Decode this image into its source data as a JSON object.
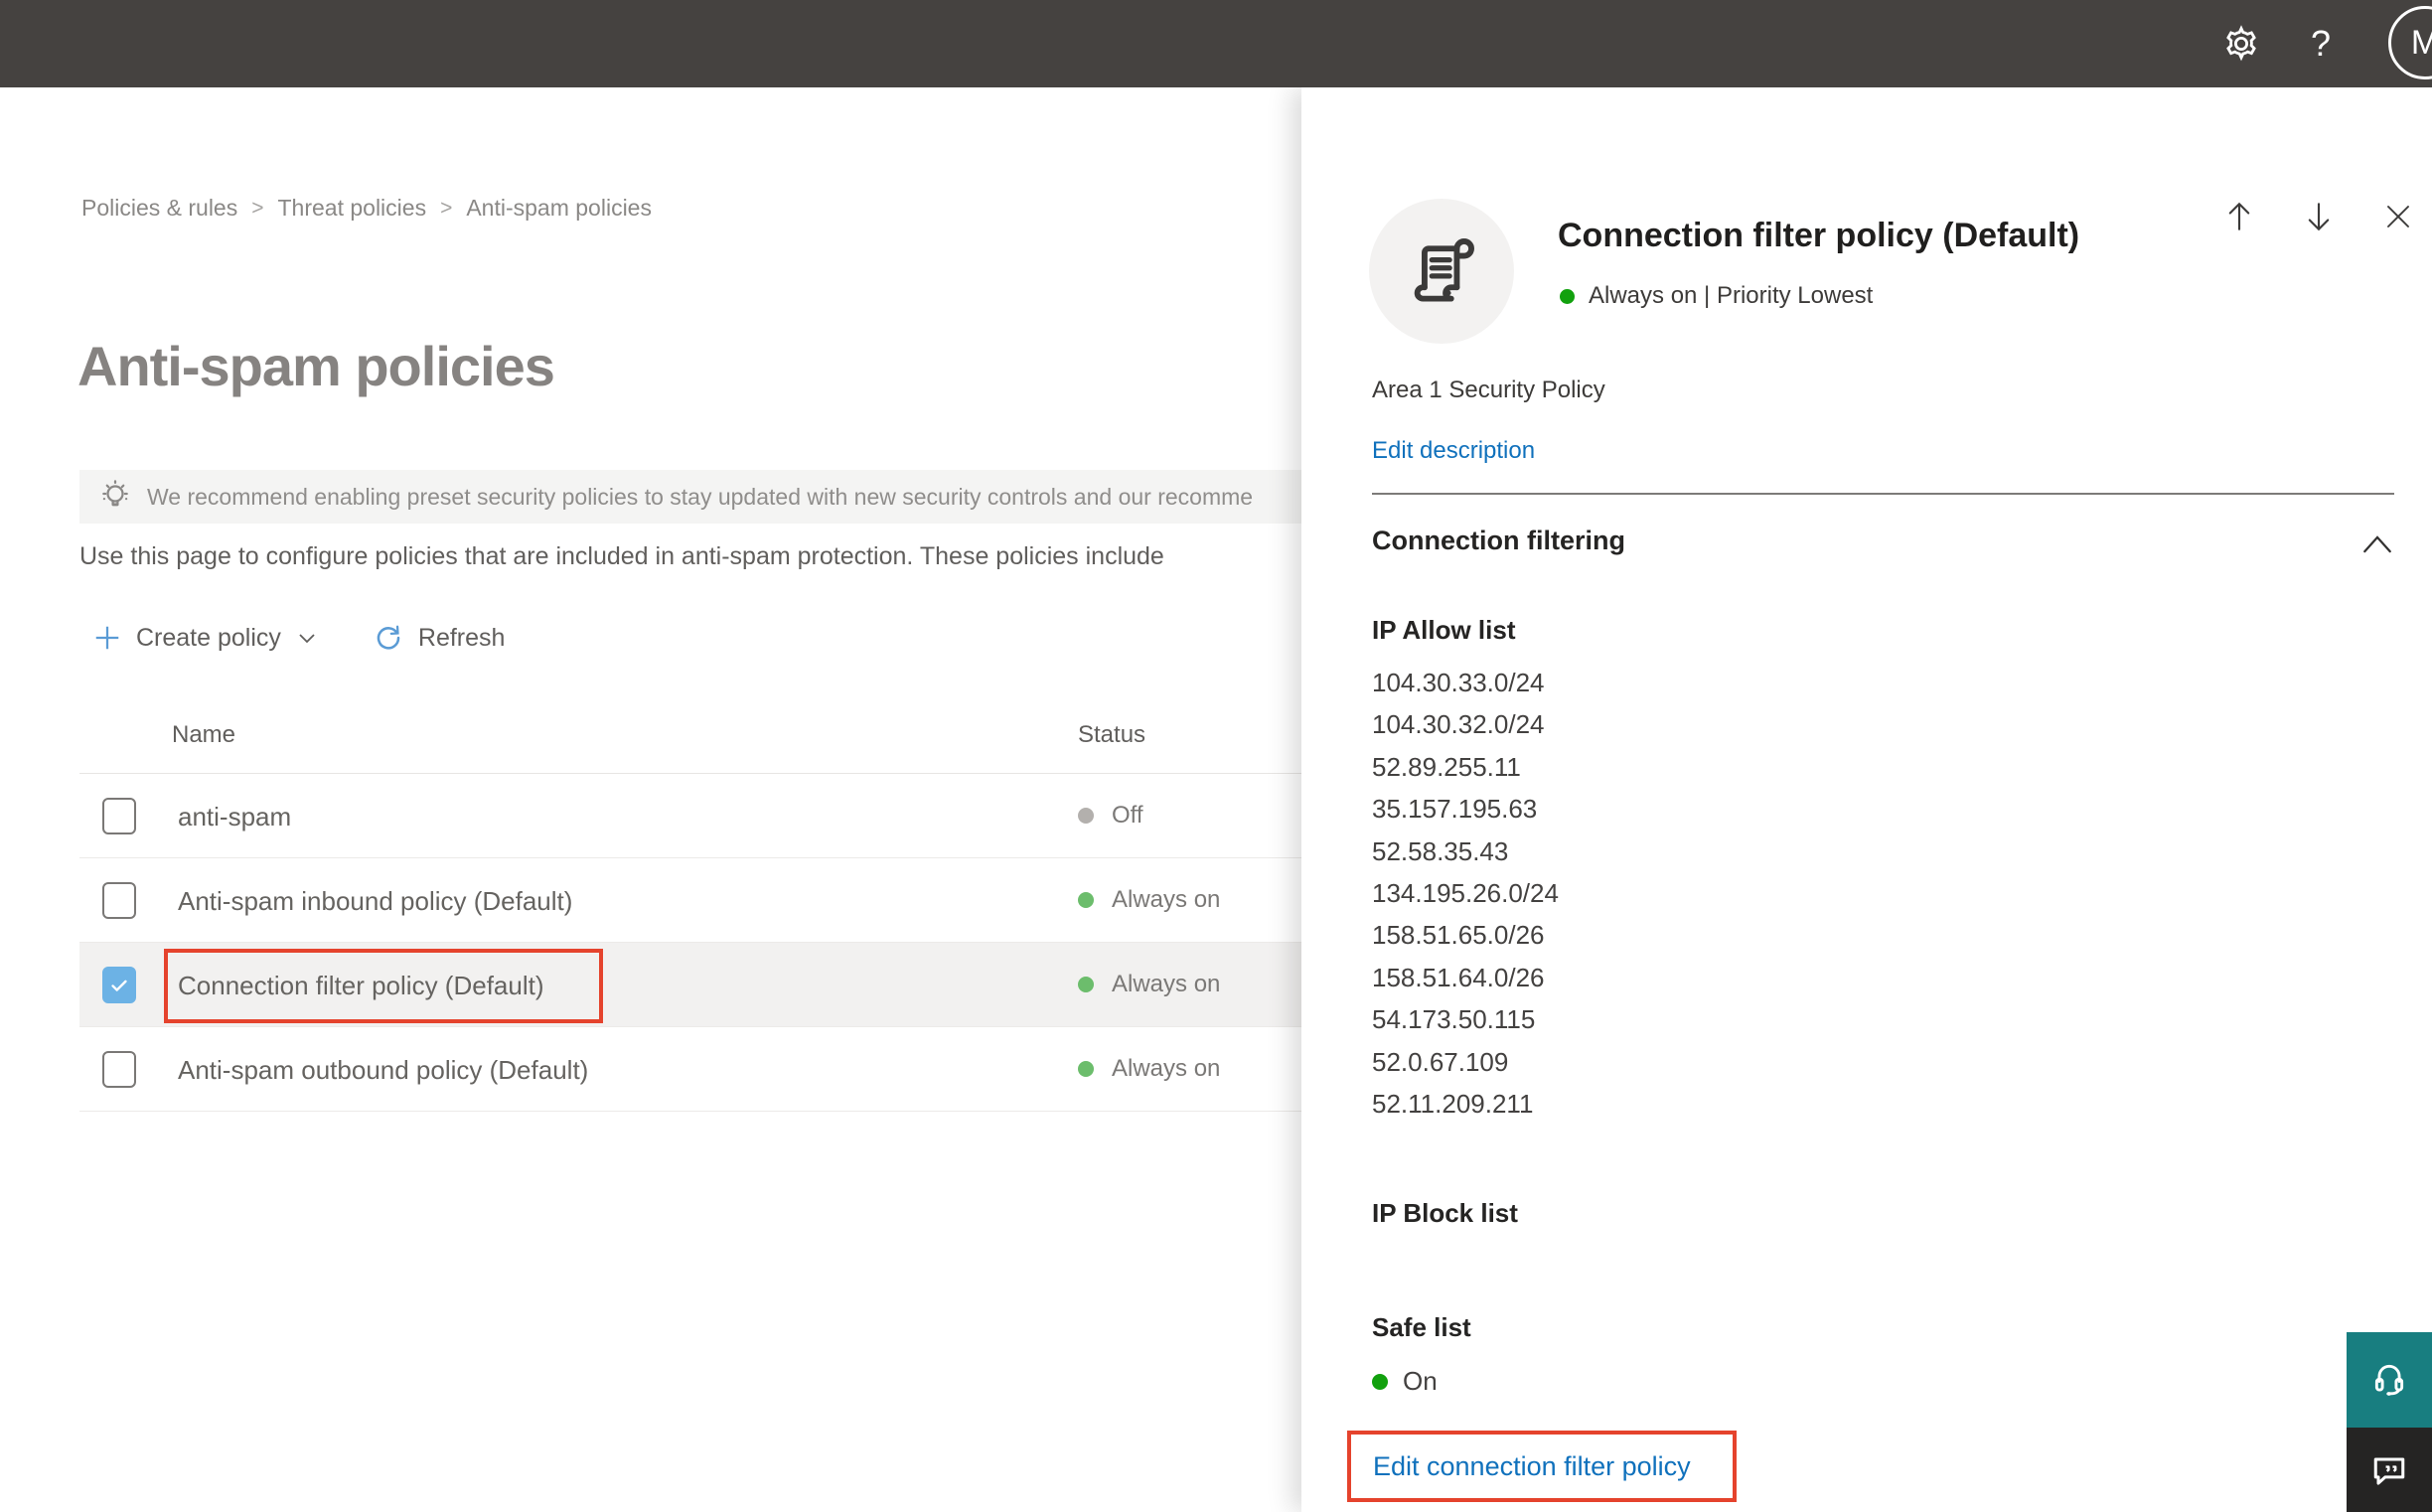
{
  "topbar": {
    "help_glyph": "?",
    "avatar_initial": "M"
  },
  "breadcrumb": {
    "separator": ">",
    "items": [
      "Policies & rules",
      "Threat policies",
      "Anti-spam policies"
    ]
  },
  "page": {
    "title": "Anti-spam policies",
    "banner_text": "We recommend enabling preset security policies to stay updated with new security controls and our recomme",
    "intro_text": "Use this page to configure policies that are included in anti-spam protection. These policies include",
    "toolbar": {
      "create_label": "Create policy",
      "refresh_label": "Refresh"
    }
  },
  "table": {
    "columns": [
      "Name",
      "Status"
    ],
    "rows": [
      {
        "name": "anti-spam",
        "status": "Off",
        "status_color": "#b3b0ad",
        "checked": false,
        "selected": false,
        "annotated": false
      },
      {
        "name": "Anti-spam inbound policy (Default)",
        "status": "Always on",
        "status_color": "#6cbd6c",
        "checked": false,
        "selected": false,
        "annotated": false
      },
      {
        "name": "Connection filter policy (Default)",
        "status": "Always on",
        "status_color": "#6cbd6c",
        "checked": true,
        "selected": true,
        "annotated": true
      },
      {
        "name": "Anti-spam outbound policy (Default)",
        "status": "Always on",
        "status_color": "#6cbd6c",
        "checked": false,
        "selected": false,
        "annotated": false
      }
    ]
  },
  "flyout": {
    "title": "Connection filter policy (Default)",
    "status_text": "Always on | Priority Lowest",
    "status_color": "#12a10e",
    "description": "Area 1 Security Policy",
    "edit_description_label": "Edit description",
    "section_title": "Connection filtering",
    "ip_allow": {
      "title": "IP Allow list",
      "items": [
        "104.30.33.0/24",
        "104.30.32.0/24",
        "52.89.255.11",
        "35.157.195.63",
        "52.58.35.43",
        "134.195.26.0/24",
        "158.51.65.0/26",
        "158.51.64.0/26",
        "54.173.50.115",
        "52.0.67.109",
        "52.11.209.211"
      ]
    },
    "ip_block": {
      "title": "IP Block list"
    },
    "safe_list": {
      "title": "Safe list",
      "status": "On",
      "status_color": "#12a10e"
    },
    "edit_policy_label": "Edit connection filter policy"
  },
  "colors": {
    "annotation_red": "#e5432d",
    "link_blue": "#1071bc",
    "checkbox_blue": "#6cb2e5",
    "support_teal": "#187e80",
    "topbar_gray": "#454240"
  }
}
